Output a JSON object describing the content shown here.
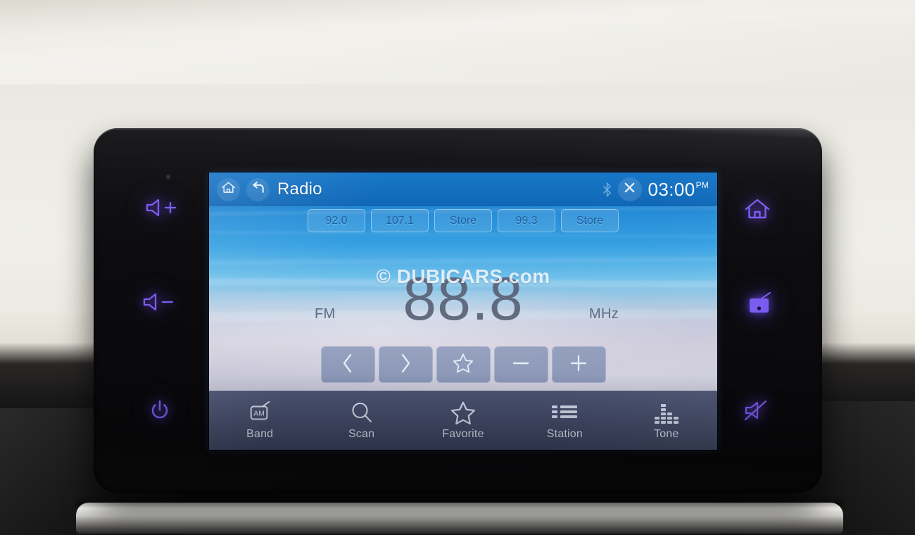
{
  "device": {
    "type": "car-infotainment-head-unit",
    "hardware_keys_left": [
      {
        "name": "volume-up",
        "icon": "speaker-plus-icon"
      },
      {
        "name": "volume-down",
        "icon": "speaker-minus-icon"
      },
      {
        "name": "power",
        "icon": "power-icon"
      }
    ],
    "hardware_keys_right": [
      {
        "name": "home",
        "icon": "home-icon"
      },
      {
        "name": "radio",
        "icon": "radio-icon"
      },
      {
        "name": "mute",
        "icon": "speaker-mute-icon"
      }
    ],
    "key_glow_color": "#7b5cf0"
  },
  "titlebar": {
    "home_icon": "home-icon",
    "back_icon": "back-arrow-icon",
    "title": "Radio",
    "bluetooth_icon": "bluetooth-icon",
    "close_icon": "close-x-icon",
    "clock": "03:00",
    "meridiem": "PM",
    "bg_color": "#0f6cbe"
  },
  "presets": [
    {
      "label": "92.0"
    },
    {
      "label": "107.1"
    },
    {
      "label": "Store"
    },
    {
      "label": "99.3"
    },
    {
      "label": "Store"
    }
  ],
  "tuner": {
    "band": "FM",
    "frequency": "88.8",
    "unit": "MHz"
  },
  "watermark": "© DUBICARS.com",
  "controls": [
    {
      "name": "seek-down",
      "glyph": "<"
    },
    {
      "name": "seek-up",
      "glyph": ">"
    },
    {
      "name": "favorite",
      "glyph": "star"
    },
    {
      "name": "tune-down",
      "glyph": "–"
    },
    {
      "name": "tune-up",
      "glyph": "+"
    }
  ],
  "bottomnav": [
    {
      "label": "Band",
      "icon": "am-radio-icon",
      "badge": "AM"
    },
    {
      "label": "Scan",
      "icon": "search-icon"
    },
    {
      "label": "Favorite",
      "icon": "star-icon"
    },
    {
      "label": "Station",
      "icon": "list-icon"
    },
    {
      "label": "Tone",
      "icon": "equalizer-icon"
    }
  ]
}
